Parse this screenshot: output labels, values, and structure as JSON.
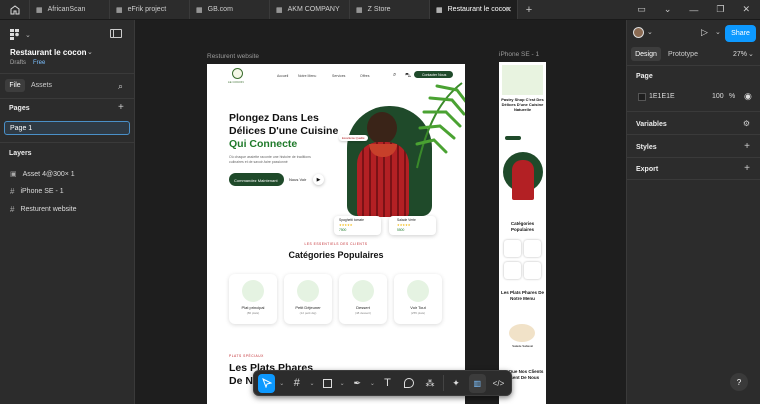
{
  "tabs": [
    {
      "label": "AfricanScan",
      "active": false
    },
    {
      "label": "eFrik project",
      "active": false
    },
    {
      "label": "GB.com",
      "active": false
    },
    {
      "label": "AKM COMPANY",
      "active": false
    },
    {
      "label": "Z Store",
      "active": false
    },
    {
      "label": "Restaurant le cocon",
      "active": true
    }
  ],
  "left": {
    "file_name": "Restaurant le cocon",
    "drafts": "Drafts",
    "plan": "Free",
    "tab_file": "File",
    "tab_assets": "Assets",
    "pages_label": "Pages",
    "page1": "Page 1",
    "layers_label": "Layers",
    "layers": [
      "Asset 4@300× 1",
      "iPhone SE - 1",
      "Resturent website"
    ]
  },
  "canvas": {
    "frame1_label": "Resturent website",
    "frame2_label": "iPhone SE - 1"
  },
  "web": {
    "logo_text": "LE COCON",
    "nav": [
      "Accueil",
      "Notre Menu",
      "Services",
      "Offres"
    ],
    "cta_nav": "Contacter Nous",
    "hero_line1": "Plongez Dans Les",
    "hero_line2": "Délices D'une Cuisine",
    "hero_line3": "Qui Connecte",
    "hero_desc": "Où chaque assiette raconte une histoire de traditions culinaires et de savoir-faire passionné",
    "btn_order": "Commandez Maintenant",
    "btn_watch": "Nous Voir",
    "badge_quality": "Excellente Qualité",
    "card1_name": "Spaghetti tomate",
    "card1_price": "7500",
    "card2_name": "Salade Verte",
    "card2_price": "5500",
    "cat_small": "LES ESSENTIELS DES CLIENTS",
    "cat_title": "Catégories Populaires",
    "cats": [
      {
        "name": "Plat principal",
        "sub": "(86 plats)"
      },
      {
        "name": "Petit Déjeuner",
        "sub": "(12 petit déj)"
      },
      {
        "name": "Dessert",
        "sub": "(48 dessert)"
      },
      {
        "name": "Voir Tout",
        "sub": "(255 plats)"
      }
    ],
    "special_small": "PLATS SPÉCIAUX",
    "special_title1": "Les Plats Phares",
    "special_title2": "De Notre Menu"
  },
  "phone": {
    "title": "Pastry Shop C'est Des Délices D'une Cuisine Naturelle",
    "cat_title": "Catégories Populaires",
    "special_title": "Les Plats Phares De Notre Menu",
    "item": "Salade Saltaval",
    "testi_title": "Ce Que Nos Clients Disent De Nous"
  },
  "right": {
    "tab_design": "Design",
    "tab_prototype": "Prototype",
    "zoom": "27%",
    "share": "Share",
    "page_label": "Page",
    "page_color": "1E1E1E",
    "page_opacity": "100",
    "percent": "%",
    "variables": "Variables",
    "styles": "Styles",
    "export": "Export"
  },
  "colors": {
    "accent": "#0d99ff",
    "brand_green": "#1f4a2a",
    "red": "#c0282d"
  }
}
